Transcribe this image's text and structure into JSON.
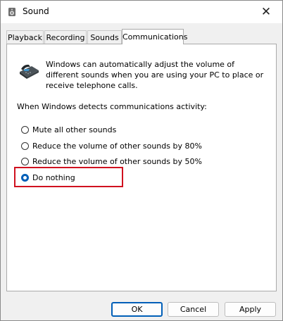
{
  "window": {
    "title": "Sound",
    "close_glyph": "✕"
  },
  "tabs": [
    {
      "label": "Playback"
    },
    {
      "label": "Recording"
    },
    {
      "label": "Sounds"
    },
    {
      "label": "Communications",
      "active": true
    }
  ],
  "communications": {
    "description": "Windows can automatically adjust the volume of different sounds when you are using your PC to place or receive telephone calls.",
    "prompt": "When Windows detects communications activity:",
    "options": [
      {
        "label": "Mute all other sounds",
        "checked": false
      },
      {
        "label": "Reduce the volume of other sounds by 80%",
        "checked": false
      },
      {
        "label": "Reduce the volume of other sounds by 50%",
        "checked": false
      },
      {
        "label": "Do nothing",
        "checked": true
      }
    ],
    "highlight_color": "#d0111f"
  },
  "buttons": {
    "ok": "OK",
    "cancel": "Cancel",
    "apply": "Apply"
  },
  "icons": {
    "app": "speaker-icon",
    "header": "telephone-icon",
    "close": "close-icon"
  },
  "colors": {
    "accent": "#005fb8",
    "dialog_bg": "#f0f0f0",
    "panel_bg": "#ffffff"
  }
}
